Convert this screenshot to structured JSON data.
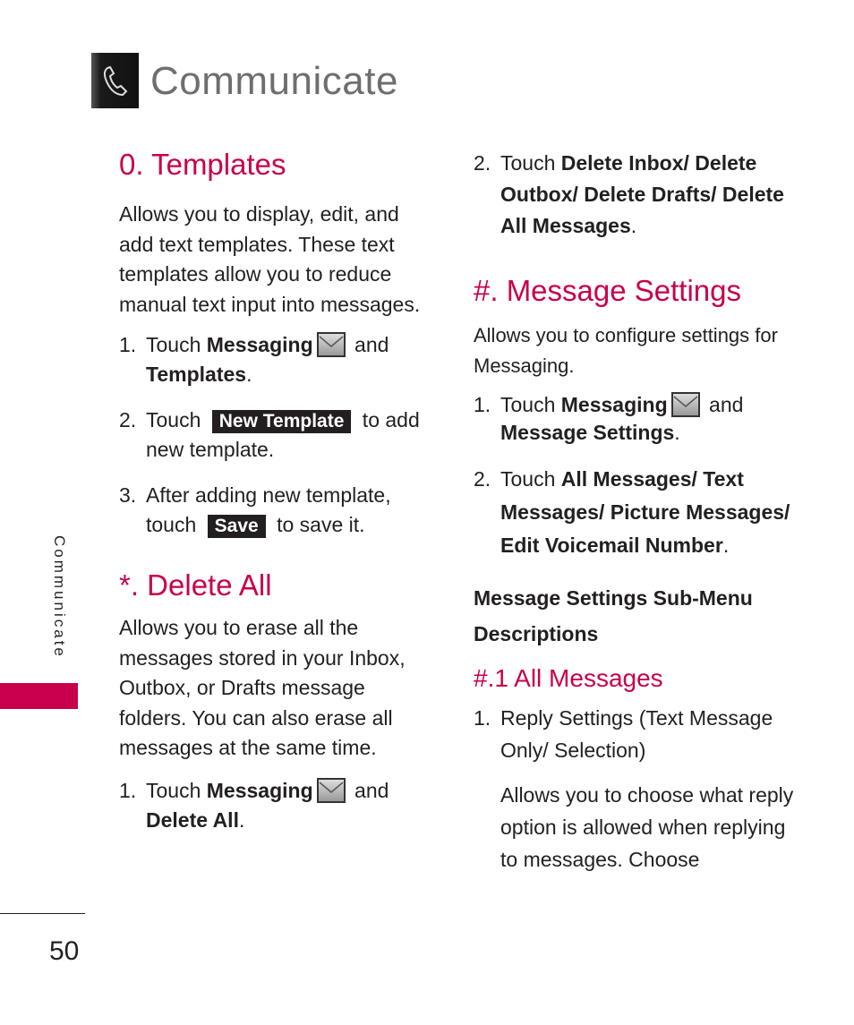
{
  "header": {
    "title": "Communicate",
    "icon": "phone-icon"
  },
  "side_tab": {
    "label": "Communicate",
    "accent_color": "#c8004c"
  },
  "footer": {
    "page_number": "50"
  },
  "colors": {
    "heading": "#c8004c",
    "title_gray": "#6d6e70",
    "text": "#231f20"
  },
  "templates": {
    "heading": "0. Templates",
    "intro": "Allows you to display, edit, and add text templates. These text templates allow you to reduce manual text input into messages.",
    "steps": [
      {
        "num": "1.",
        "pre": "Touch ",
        "bold1": "Messaging",
        "mid": " and ",
        "bold2": "Templates",
        "post": "."
      },
      {
        "num": "2.",
        "pre": "Touch ",
        "button": "New Template",
        "post": " to add new template."
      },
      {
        "num": "3.",
        "pre": "After adding new template, touch ",
        "button": "Save",
        "post": " to save it."
      }
    ]
  },
  "delete_all": {
    "heading": "*. Delete All",
    "intro": "Allows you to erase all the messages stored in your Inbox, Outbox, or Drafts message folders. You can also erase all messages at the same time.",
    "step1": {
      "num": "1.",
      "pre": "Touch ",
      "bold1": "Messaging",
      "mid": " and ",
      "bold2": "Delete All",
      "post": "."
    },
    "step2": {
      "num": "2.",
      "pre": "Touch ",
      "bold": "Delete Inbox/ Delete Outbox/ Delete Drafts/ Delete All Messages",
      "post": "."
    }
  },
  "message_settings": {
    "heading": "#. Message Settings",
    "intro": "Allows you to configure settings for Messaging.",
    "step1": {
      "num": "1.",
      "pre": "Touch ",
      "bold1": "Messaging",
      "mid": " and ",
      "bold2": "Message Settings",
      "post": "."
    },
    "step2": {
      "num": "2.",
      "pre": "Touch ",
      "bold": "All Messages/ Text Messages/ Picture Messages/ Edit Voicemail Number",
      "post": "."
    },
    "submenu_heading": "Message Settings Sub-Menu Descriptions",
    "all_messages": {
      "heading": "#.1 All Messages",
      "item": {
        "num": "1.",
        "label": "Reply Settings (Text Message Only/ Selection)"
      },
      "desc": "Allows you to choose what reply option is allowed when replying to messages. Choose"
    }
  }
}
